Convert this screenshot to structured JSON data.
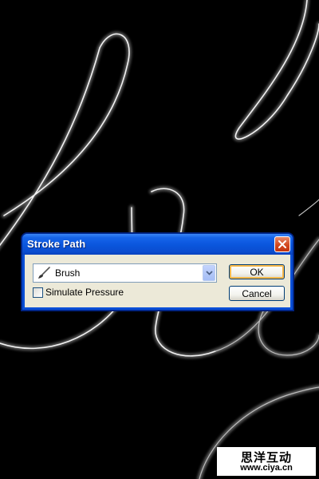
{
  "dialog": {
    "title": "Stroke Path",
    "tool_select": {
      "selected": "Brush",
      "icon": "brush-icon"
    },
    "simulate_pressure": {
      "label": "Simulate Pressure",
      "checked": false
    },
    "ok_label": "OK",
    "cancel_label": "Cancel"
  },
  "watermark": {
    "text": "思洋互动",
    "url": "www.ciya.cn"
  },
  "colors": {
    "title_bar": "#0a55dc",
    "client_bg": "#ece9d8",
    "close_button": "#d3481e",
    "canvas_bg": "#000000"
  }
}
